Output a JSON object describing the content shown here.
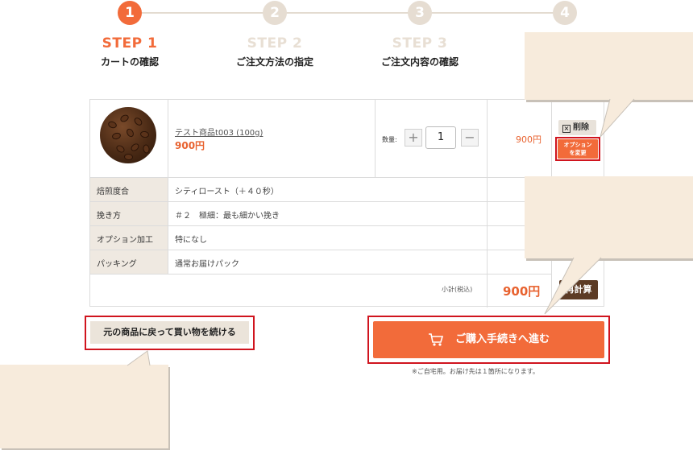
{
  "steps": [
    {
      "number": "1",
      "title": "STEP 1",
      "label": "カートの確認",
      "active": true
    },
    {
      "number": "2",
      "title": "STEP 2",
      "label": "ご注文方法の指定",
      "active": false
    },
    {
      "number": "3",
      "title": "STEP 3",
      "label": "ご注文内容の確認",
      "active": false
    },
    {
      "number": "4",
      "title": "",
      "label": "",
      "active": false
    }
  ],
  "cart": {
    "item": {
      "name": "テスト商品t003 (100g)",
      "price": "900円",
      "qty_label": "数量",
      "qty": "1",
      "line_total": "900円",
      "delete_label": "削除",
      "option_change_label_1": "オプション",
      "option_change_label_2": "を変更"
    },
    "options": [
      {
        "label": "焙煎度合",
        "value": "シティロースト（＋４０秒）"
      },
      {
        "label": "挽き方",
        "value": "＃２　極細：最も細かい挽き"
      },
      {
        "label": "オプション加工",
        "value": "特になし"
      },
      {
        "label": "パッキング",
        "value": "通常お届けパック"
      }
    ],
    "subtotal_label": "小計(税込)",
    "subtotal_value": "900円",
    "recalc_label": "再計算"
  },
  "actions": {
    "back_label": "元の商品に戻って買い物を続ける",
    "checkout_label": "ご購入手続きへ進む",
    "note": "※ご自宅用。お届け先は１箇所になります。"
  },
  "colors": {
    "accent": "#f26b3a",
    "brown": "#5c3b25",
    "callout": "#f7ebdc",
    "highlight": "#d0141e"
  }
}
